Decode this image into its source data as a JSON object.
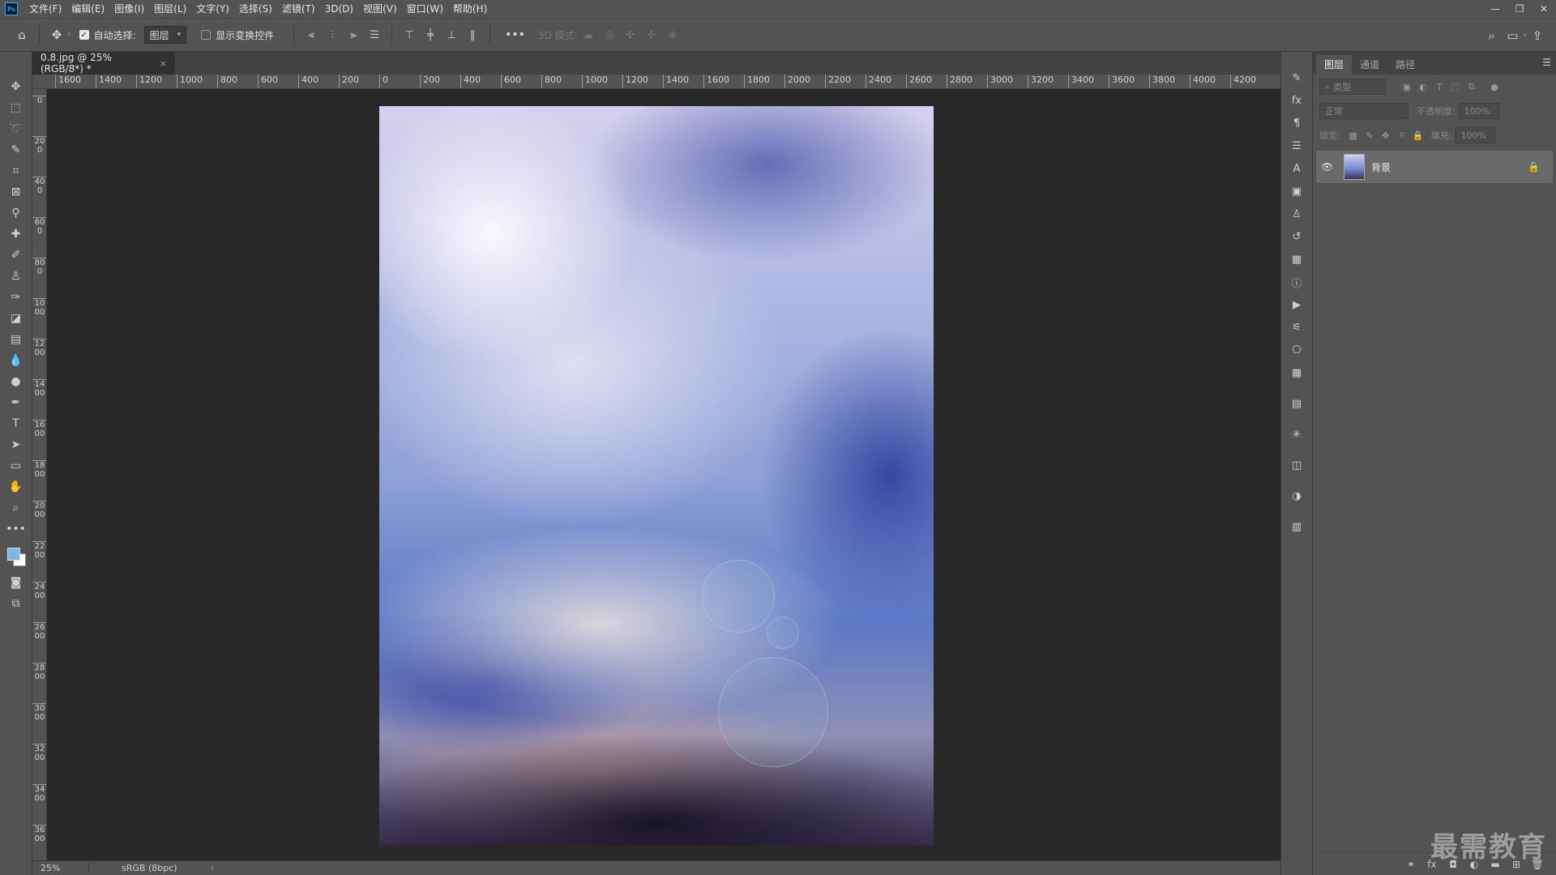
{
  "menubar": {
    "logo": "Ps",
    "items": [
      "文件(F)",
      "编辑(E)",
      "图像(I)",
      "图层(L)",
      "文字(Y)",
      "选择(S)",
      "滤镜(T)",
      "3D(D)",
      "视图(V)",
      "窗口(W)",
      "帮助(H)"
    ],
    "window_controls": [
      "—",
      "❐",
      "✕"
    ]
  },
  "options": {
    "auto_select_label": "自动选择:",
    "auto_select_target": "图层",
    "show_transform_label": "显示变换控件",
    "more": "•••",
    "mode_3d_label": "3D 模式:"
  },
  "document": {
    "tab_title": "0.8.jpg @ 25%(RGB/8*) *",
    "close": "×"
  },
  "ruler": {
    "h_ticks": [
      "1600",
      "1400",
      "1200",
      "1000",
      "800",
      "600",
      "400",
      "200",
      "0",
      "200",
      "400",
      "600",
      "800",
      "1000",
      "1200",
      "1400",
      "1600",
      "1800",
      "2000",
      "2200",
      "2400",
      "2600",
      "2800",
      "3000",
      "3200",
      "3400",
      "3600",
      "3800",
      "4000",
      "4200"
    ],
    "v_ticks": [
      "0",
      "200",
      "400",
      "600",
      "800",
      "1000",
      "1200",
      "1400",
      "1600",
      "1800",
      "2000",
      "2200",
      "2400",
      "2600",
      "2800",
      "3000",
      "3200",
      "3400",
      "3600"
    ]
  },
  "layers_panel": {
    "tabs": [
      "图层",
      "通道",
      "路径"
    ],
    "filter_label": "类型",
    "blend_mode": "正常",
    "opacity_label": "不透明度:",
    "opacity_value": "100%",
    "lock_label": "锁定:",
    "fill_label": "填充:",
    "fill_value": "100%",
    "layer": {
      "name": "背景"
    }
  },
  "status": {
    "zoom": "25%",
    "color_profile": "sRGB (8bpc)",
    "caret": "›"
  },
  "watermark": "最需教育",
  "colors": {
    "ui_dark": "#282828",
    "ui_panel": "#535353",
    "foreground_swatch": "#7cb8e8",
    "background_swatch": "#ffffff"
  }
}
